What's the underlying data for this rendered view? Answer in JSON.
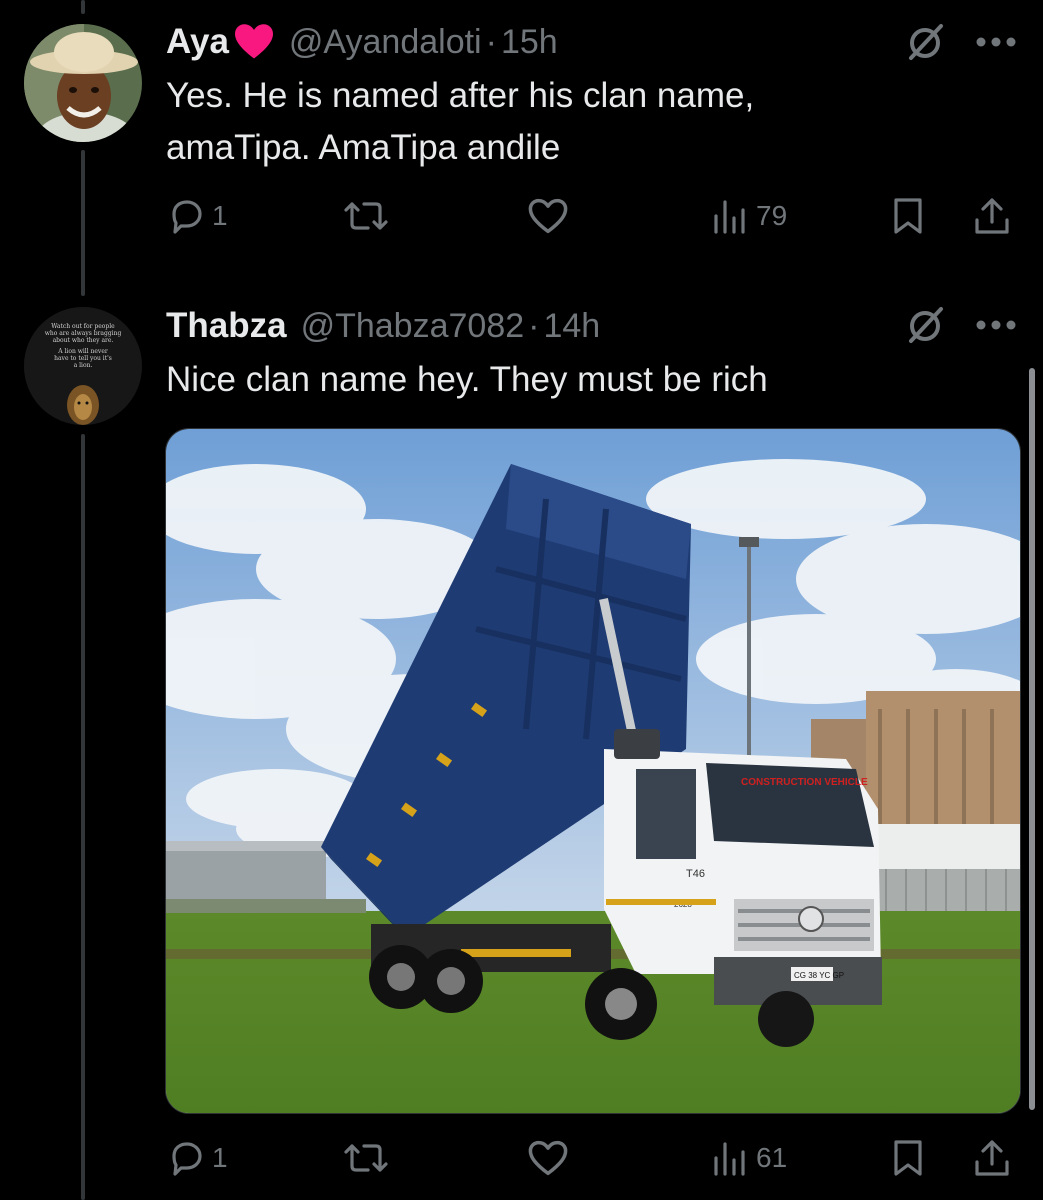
{
  "posts": [
    {
      "display_name": "Aya",
      "handle": "@Ayandaloti",
      "separator": "·",
      "time": "15h",
      "text_lines": [
        "Yes. He is named after his clan name,",
        "amaTipa. AmaTipa andile"
      ],
      "actions": {
        "reply_count": "1",
        "retweet_count": "",
        "like_count": "",
        "views_count": "79"
      }
    },
    {
      "display_name": "Thabza",
      "handle": "@Thabza7082",
      "separator": "·",
      "time": "14h",
      "text_lines": [
        "Nice clan name hey. They must be rich"
      ],
      "avatar_text": [
        "Watch out for people",
        "who are always bragging",
        "about who they are.",
        "A lion will never",
        "have to tell you it's",
        "a lion."
      ],
      "media": {
        "description_icon": "dump-truck-photo",
        "truck_fleet_no": "T46",
        "truck_model": "2628",
        "windshield_sign": "CONSTRUCTION VEHICLE",
        "plate": "CG 38 YC GP"
      },
      "actions": {
        "reply_count": "1",
        "retweet_count": "",
        "like_count": "",
        "views_count": "61"
      }
    }
  ],
  "colors": {
    "background": "#000000",
    "text": "#e7e9ea",
    "muted": "#71767b",
    "heart": "#f91880"
  }
}
